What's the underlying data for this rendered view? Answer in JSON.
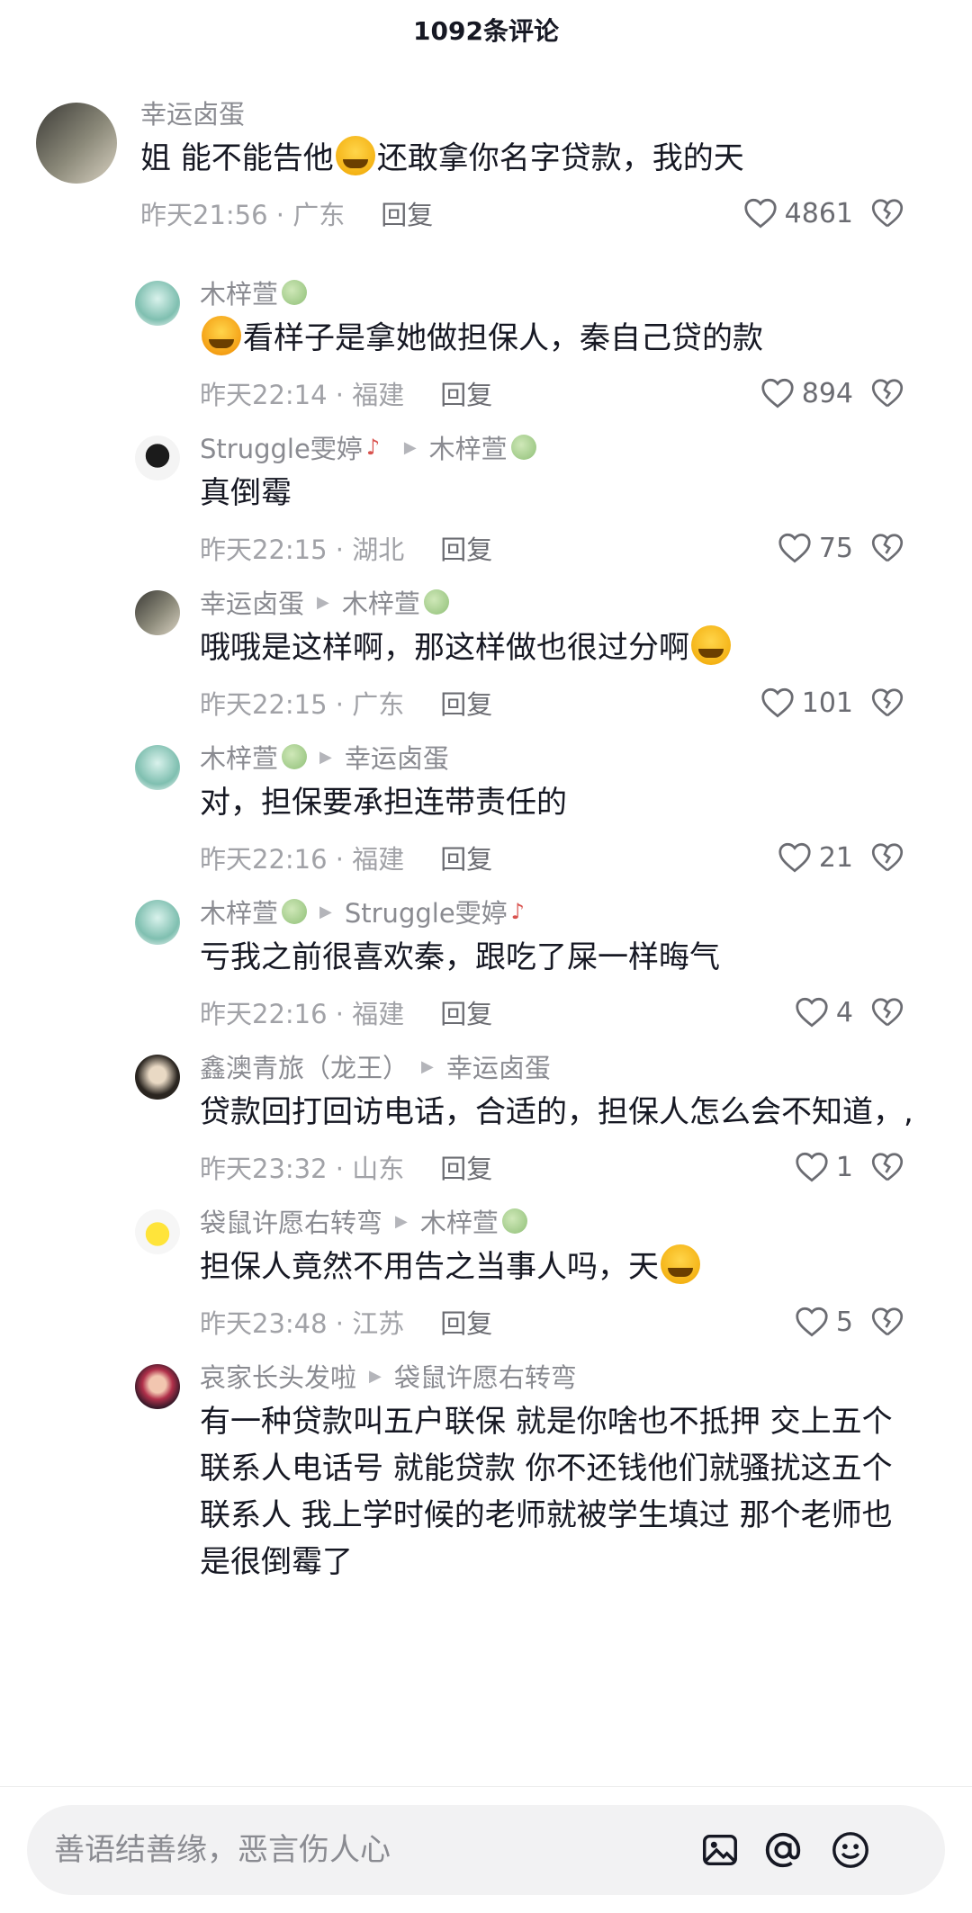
{
  "header": {
    "title": "1092条评论"
  },
  "colors": {
    "text": "#161823",
    "meta": "#a1a2a7",
    "name": "#8a8b91",
    "background": "#ffffff",
    "input_bg": "#f2f2f3"
  },
  "comments": [
    {
      "type": "top",
      "user": "幸运卤蛋",
      "text_before": "姐 能不能告他",
      "emoji": "crying-face",
      "text_after": "还敢拿你名字贷款，我的天",
      "time": "昨天21:56 · 广东",
      "reply_label": "回复",
      "likes": "4861"
    },
    {
      "type": "reply",
      "user": "木梓萱",
      "user_icon": "tree-icon",
      "text_before": "",
      "emoji": "laughing-face",
      "text_after": "看样子是拿她做担保人，秦自己贷的款",
      "time": "昨天22:14 · 福建",
      "reply_label": "回复",
      "likes": "894"
    },
    {
      "type": "reply",
      "user": "Struggle雯婷",
      "user_icon": "guitar-icon",
      "reply_to": "木梓萱",
      "reply_to_icon": "tree-icon",
      "text_after": "真倒霉",
      "time": "昨天22:15 · 湖北",
      "reply_label": "回复",
      "likes": "75"
    },
    {
      "type": "reply",
      "user": "幸运卤蛋",
      "reply_to": "木梓萱",
      "reply_to_icon": "tree-icon",
      "text_before": "哦哦是这样啊，那这样做也很过分啊",
      "emoji": "crying-face",
      "time": "昨天22:15 · 广东",
      "reply_label": "回复",
      "likes": "101"
    },
    {
      "type": "reply",
      "user": "木梓萱",
      "user_icon": "tree-icon",
      "reply_to": "幸运卤蛋",
      "text_after": "对，担保要承担连带责任的",
      "time": "昨天22:16 · 福建",
      "reply_label": "回复",
      "likes": "21"
    },
    {
      "type": "reply",
      "user": "木梓萱",
      "user_icon": "tree-icon",
      "reply_to": "Struggle雯婷",
      "reply_to_icon": "guitar-icon",
      "text_after": "亏我之前很喜欢秦，跟吃了屎一样晦气",
      "time": "昨天22:16 · 福建",
      "reply_label": "回复",
      "likes": "4"
    },
    {
      "type": "reply",
      "user": "鑫澳青旅（龙王）",
      "reply_to": "幸运卤蛋",
      "text_after": "贷款回打回访电话，合适的，担保人怎么会不知道，,",
      "time": "昨天23:32 · 山东",
      "reply_label": "回复",
      "likes": "1"
    },
    {
      "type": "reply",
      "user": "袋鼠许愿右转弯",
      "reply_to": "木梓萱",
      "reply_to_icon": "tree-icon",
      "text_before": "担保人竟然不用告之当事人吗，天",
      "emoji": "crying-face",
      "time": "昨天23:48 · 江苏",
      "reply_label": "回复",
      "likes": "5"
    },
    {
      "type": "reply",
      "user": "哀家长头发啦",
      "reply_to": "袋鼠许愿右转弯",
      "text_after": "有一种贷款叫五户联保 就是你啥也不抵押 交上五个联系人电话号 就能贷款 你不还钱他们就骚扰这五个联系人 我上学时候的老师就被学生填过 那个老师也是很倒霉了"
    }
  ],
  "input": {
    "placeholder": "善语结善缘，恶言伤人心"
  },
  "toolbar": {
    "icons": [
      "image-icon",
      "at-icon",
      "emoji-icon"
    ]
  }
}
